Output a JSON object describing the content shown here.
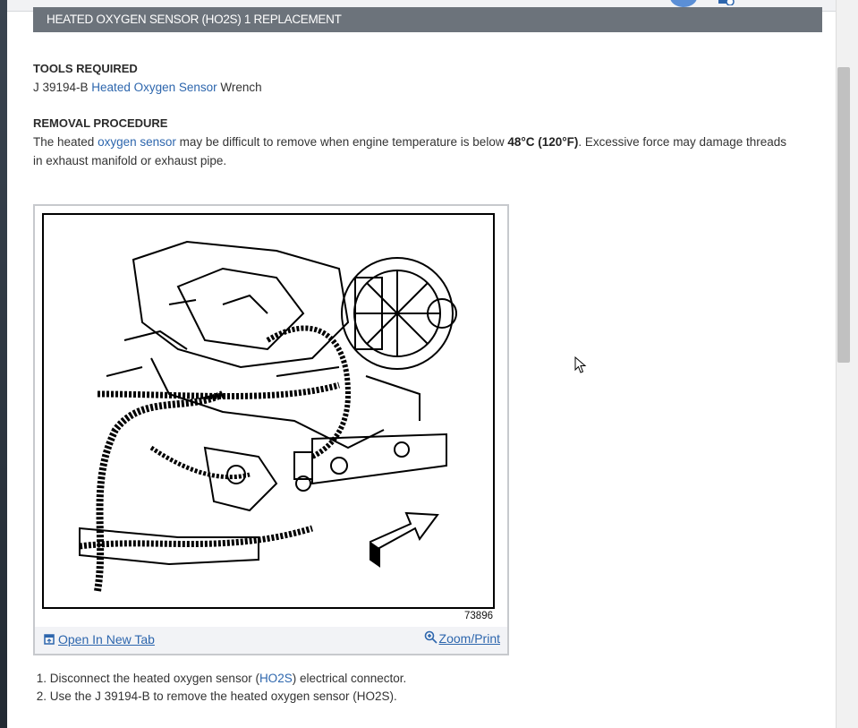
{
  "header": {
    "title": "HEATED OXYGEN SENSOR (HO2S) 1 REPLACEMENT"
  },
  "tools": {
    "heading": "TOOLS REQUIRED",
    "prefix": "J 39194-B ",
    "link": "Heated Oxygen Sensor",
    "suffix": " Wrench"
  },
  "removal": {
    "heading": "REMOVAL PROCEDURE",
    "p1_a": " The heated ",
    "p1_link": "oxygen sensor",
    "p1_b": " may be difficult to remove when engine temperature is below ",
    "p1_bold": "48°C (120°F)",
    "p1_c": ". Excessive force may damage threads",
    "p2": "in exhaust manifold or exhaust pipe."
  },
  "figure": {
    "number": "73896",
    "open_label": "Open In New Tab",
    "zoom_label": "Zoom/Print"
  },
  "steps": [
    {
      "num": "1.",
      "a": "Disconnect the heated oxygen sensor (",
      "link": "HO2S",
      "b": ") electrical connector."
    },
    {
      "num": "2.",
      "a": "Use the J 39194-B to remove the heated oxygen sensor (HO2S).",
      "link": "",
      "b": ""
    }
  ],
  "colors": {
    "header_bg": "#6c737b",
    "link": "#2d66ad"
  }
}
